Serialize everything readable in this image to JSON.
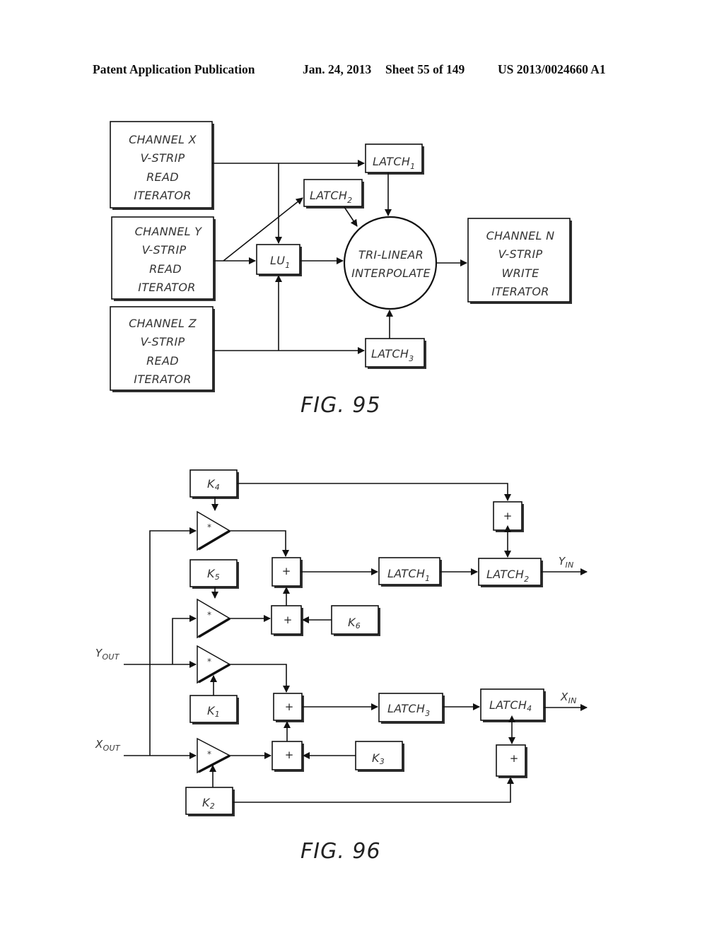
{
  "header": {
    "publication": "Patent Application Publication",
    "date": "Jan. 24, 2013",
    "sheet": "Sheet 55 of 149",
    "number": "US 2013/0024660 A1"
  },
  "fig95": {
    "caption": "FIG. 95",
    "channel_x": [
      "CHANNEL X",
      "V-STRIP",
      "READ",
      "ITERATOR"
    ],
    "channel_y": [
      "CHANNEL Y",
      "V-STRIP",
      "READ",
      "ITERATOR"
    ],
    "channel_z": [
      "CHANNEL Z",
      "V-STRIP",
      "READ",
      "ITERATOR"
    ],
    "channel_n": [
      "CHANNEL N",
      "V-STRIP",
      "WRITE",
      "ITERATOR"
    ],
    "latch1": {
      "base": "LATCH",
      "sub": "1"
    },
    "latch2": {
      "base": "LATCH",
      "sub": "2"
    },
    "latch3": {
      "base": "LATCH",
      "sub": "3"
    },
    "lu1": {
      "base": "LU",
      "sub": "1"
    },
    "interpolator": [
      "TRI-LINEAR",
      "INTERPOLATE"
    ]
  },
  "fig96": {
    "caption": "FIG. 96",
    "constants": {
      "k1": {
        "base": "K",
        "sub": "1"
      },
      "k2": {
        "base": "K",
        "sub": "2"
      },
      "k3": {
        "base": "K",
        "sub": "3"
      },
      "k4": {
        "base": "K",
        "sub": "4"
      },
      "k5": {
        "base": "K",
        "sub": "5"
      },
      "k6": {
        "base": "K",
        "sub": "6"
      }
    },
    "latches": {
      "latch1": {
        "base": "LATCH",
        "sub": "1"
      },
      "latch2": {
        "base": "LATCH",
        "sub": "2"
      },
      "latch3": {
        "base": "LATCH",
        "sub": "3"
      },
      "latch4": {
        "base": "LATCH",
        "sub": "4"
      }
    },
    "multiplier_symbol": "*",
    "adder_symbol": "+",
    "inputs": {
      "y_out": {
        "base": "Y",
        "sub": "OUT"
      },
      "x_out": {
        "base": "X",
        "sub": "OUT"
      }
    },
    "outputs": {
      "y_in": {
        "base": "Y",
        "sub": "IN"
      },
      "x_in": {
        "base": "X",
        "sub": "IN"
      }
    }
  }
}
